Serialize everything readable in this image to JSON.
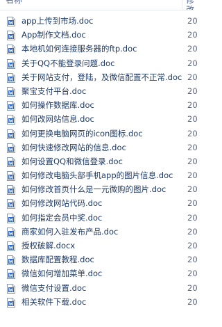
{
  "header": {
    "name_label": "名称",
    "date_label": "修改日期"
  },
  "files": [
    {
      "name": "app上传到市场.doc",
      "date": "20",
      "icon": "word-doc-icon"
    },
    {
      "name": "App制作文档.doc",
      "date": "20",
      "icon": "word-doc-icon"
    },
    {
      "name": "本地机如何连接服务器的ftp.doc",
      "date": "20",
      "icon": "word-doc-icon"
    },
    {
      "name": "关于QQ不能登录问题.doc",
      "date": "20",
      "icon": "word-doc-icon"
    },
    {
      "name": "关于网站支付，登陆，及微信配置不正常.doc",
      "date": "20",
      "icon": "word-doc-icon"
    },
    {
      "name": "聚宝支付平台.doc",
      "date": "20",
      "icon": "word-doc-icon"
    },
    {
      "name": "如何操作数据库.doc",
      "date": "20",
      "icon": "word-doc-icon"
    },
    {
      "name": "如何改网站信息.doc",
      "date": "20",
      "icon": "word-doc-icon"
    },
    {
      "name": "如何更换电脑网页的icon图标.doc",
      "date": "20",
      "icon": "word-doc-icon"
    },
    {
      "name": "如何快速修改网站的信息.doc",
      "date": "20",
      "icon": "word-doc-icon"
    },
    {
      "name": "如何设置QQ和微信登录.doc",
      "date": "20",
      "icon": "word-doc-icon"
    },
    {
      "name": "如何修改电脑头部手机app的图片信息.doc",
      "date": "20",
      "icon": "word-doc-icon"
    },
    {
      "name": "如何修改首页什么是一元微购的图片.doc",
      "date": "20",
      "icon": "word-doc-icon"
    },
    {
      "name": "如何修改网站代码.doc",
      "date": "20",
      "icon": "word-doc-icon"
    },
    {
      "name": "如何指定会员中奖.doc",
      "date": "20",
      "icon": "word-doc-icon"
    },
    {
      "name": "商家如何入驻发布产品.doc",
      "date": "20",
      "icon": "word-doc-icon"
    },
    {
      "name": "授权破解.docx",
      "date": "20",
      "icon": "word-docx-icon"
    },
    {
      "name": "数据库配置教程.doc",
      "date": "20",
      "icon": "word-doc-icon"
    },
    {
      "name": "微信如何增加菜单.doc",
      "date": "20",
      "icon": "word-doc-icon"
    },
    {
      "name": "微信支付设置.doc",
      "date": "20",
      "icon": "word-doc-icon"
    },
    {
      "name": "相关软件下载.doc",
      "date": "20",
      "icon": "word-doc-icon"
    }
  ],
  "colors": {
    "text": "#1e3a66",
    "icon_blue": "#2b63c6",
    "icon_border": "#8a98ad"
  }
}
